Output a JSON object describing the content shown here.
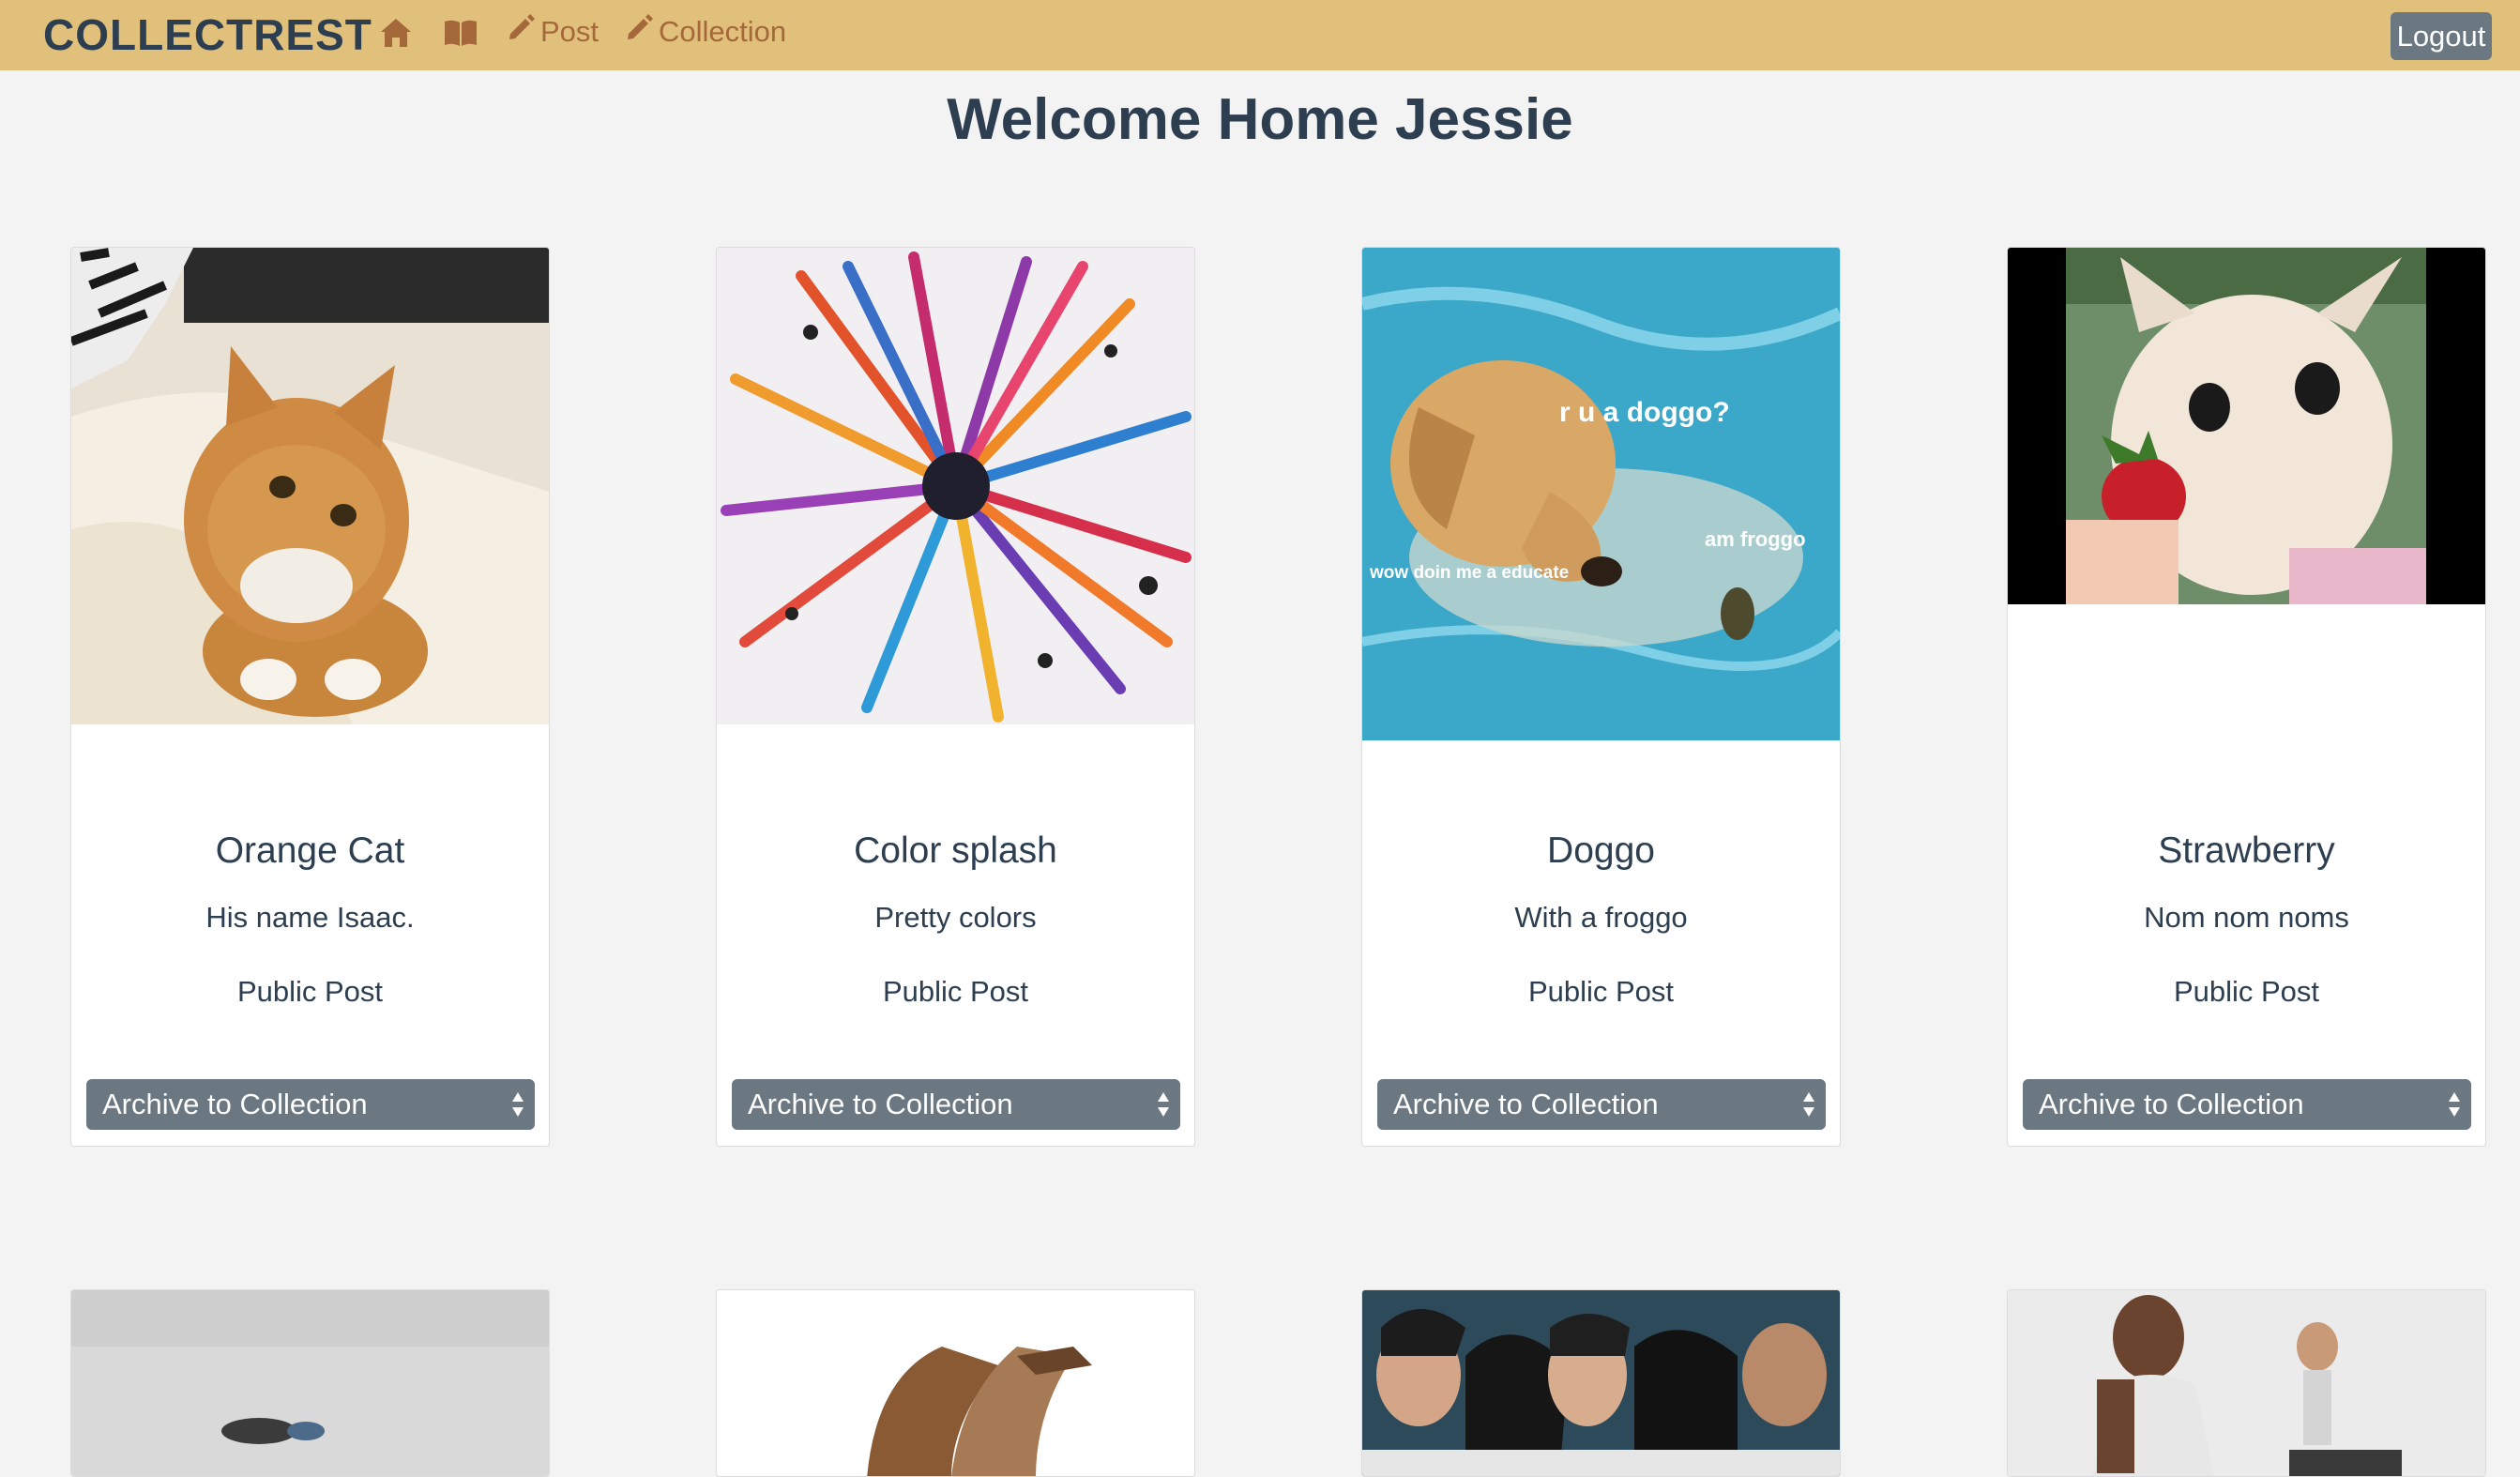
{
  "nav": {
    "brand": "COLLECTREST",
    "post_label": "Post",
    "collection_label": "Collection",
    "logout_label": "Logout",
    "icons": [
      "home-icon",
      "book-icon",
      "pencil-icon",
      "pencil-icon"
    ]
  },
  "colors": {
    "navbar": "#e0c07a",
    "link": "#a5683a",
    "button": "#6b7781",
    "text": "#2c3e50",
    "background": "#f3f3f3"
  },
  "welcome": "Welcome Home Jessie",
  "cards": [
    {
      "title": "Orange Cat",
      "description": "His name Isaac.",
      "visibility": "Public Post",
      "archive_label": "Archive to Collection"
    },
    {
      "title": "Color splash",
      "description": "Pretty colors",
      "visibility": "Public Post",
      "archive_label": "Archive to Collection"
    },
    {
      "title": "Doggo",
      "description": "With a froggo",
      "visibility": "Public Post",
      "archive_label": "Archive to Collection",
      "image_captions": {
        "main": "r u a doggo?",
        "left": "wow doin me a educate",
        "right": "am froggo"
      }
    },
    {
      "title": "Strawberry",
      "description": "Nom nom noms",
      "visibility": "Public Post",
      "archive_label": "Archive to Collection"
    }
  ]
}
